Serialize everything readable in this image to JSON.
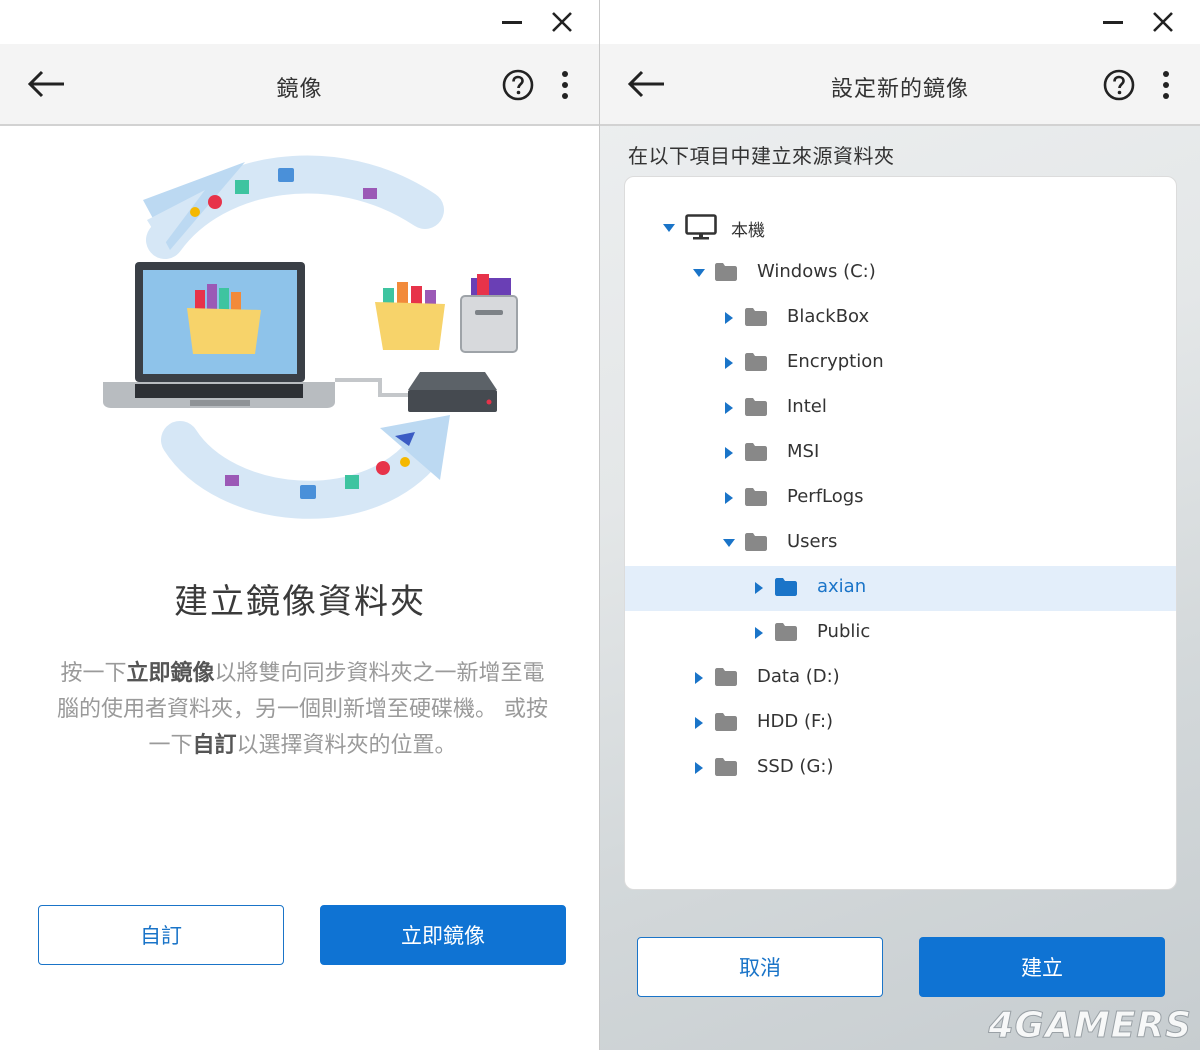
{
  "colors": {
    "accent": "#0f73d3",
    "folder_gray": "#888888",
    "folder_selected": "#1a74c8",
    "selected_row": "#e3eefa"
  },
  "left": {
    "title": "鏡像",
    "heading": "建立鏡像資料夾",
    "desc": {
      "p1": "按一下",
      "b1": "立即鏡像",
      "p2": "以將雙向同步資料夾之一新增至電腦的使用者資料夾，另一個則新增至硬碟機。 或按一下",
      "b2": "自訂",
      "p3": "以選擇資料夾的位置。"
    },
    "buttons": {
      "custom": "自訂",
      "mirror_now": "立即鏡像"
    }
  },
  "right": {
    "title": "設定新的鏡像",
    "subtitle": "在以下項目中建立來源資料夾",
    "tree": [
      {
        "label": "本機",
        "depth": 0,
        "expanded": true,
        "icon": "monitor-icon",
        "selected": false
      },
      {
        "label": "Windows (C:)",
        "depth": 1,
        "expanded": true,
        "icon": "folder-icon",
        "selected": false
      },
      {
        "label": "BlackBox",
        "depth": 2,
        "expanded": false,
        "icon": "folder-icon",
        "selected": false
      },
      {
        "label": "Encryption",
        "depth": 2,
        "expanded": false,
        "icon": "folder-icon",
        "selected": false
      },
      {
        "label": "Intel",
        "depth": 2,
        "expanded": false,
        "icon": "folder-icon",
        "selected": false
      },
      {
        "label": "MSI",
        "depth": 2,
        "expanded": false,
        "icon": "folder-icon",
        "selected": false
      },
      {
        "label": "PerfLogs",
        "depth": 2,
        "expanded": false,
        "icon": "folder-icon",
        "selected": false
      },
      {
        "label": "Users",
        "depth": 2,
        "expanded": true,
        "icon": "folder-icon",
        "selected": false
      },
      {
        "label": "axian",
        "depth": 3,
        "expanded": false,
        "icon": "folder-icon",
        "selected": true
      },
      {
        "label": "Public",
        "depth": 3,
        "expanded": false,
        "icon": "folder-icon",
        "selected": false
      },
      {
        "label": "Data (D:)",
        "depth": 1,
        "expanded": false,
        "icon": "folder-icon",
        "selected": false
      },
      {
        "label": "HDD (F:)",
        "depth": 1,
        "expanded": false,
        "icon": "folder-icon",
        "selected": false
      },
      {
        "label": "SSD (G:)",
        "depth": 1,
        "expanded": false,
        "icon": "folder-icon",
        "selected": false
      }
    ],
    "buttons": {
      "cancel": "取消",
      "create": "建立"
    }
  },
  "watermark": "4GAMERS"
}
